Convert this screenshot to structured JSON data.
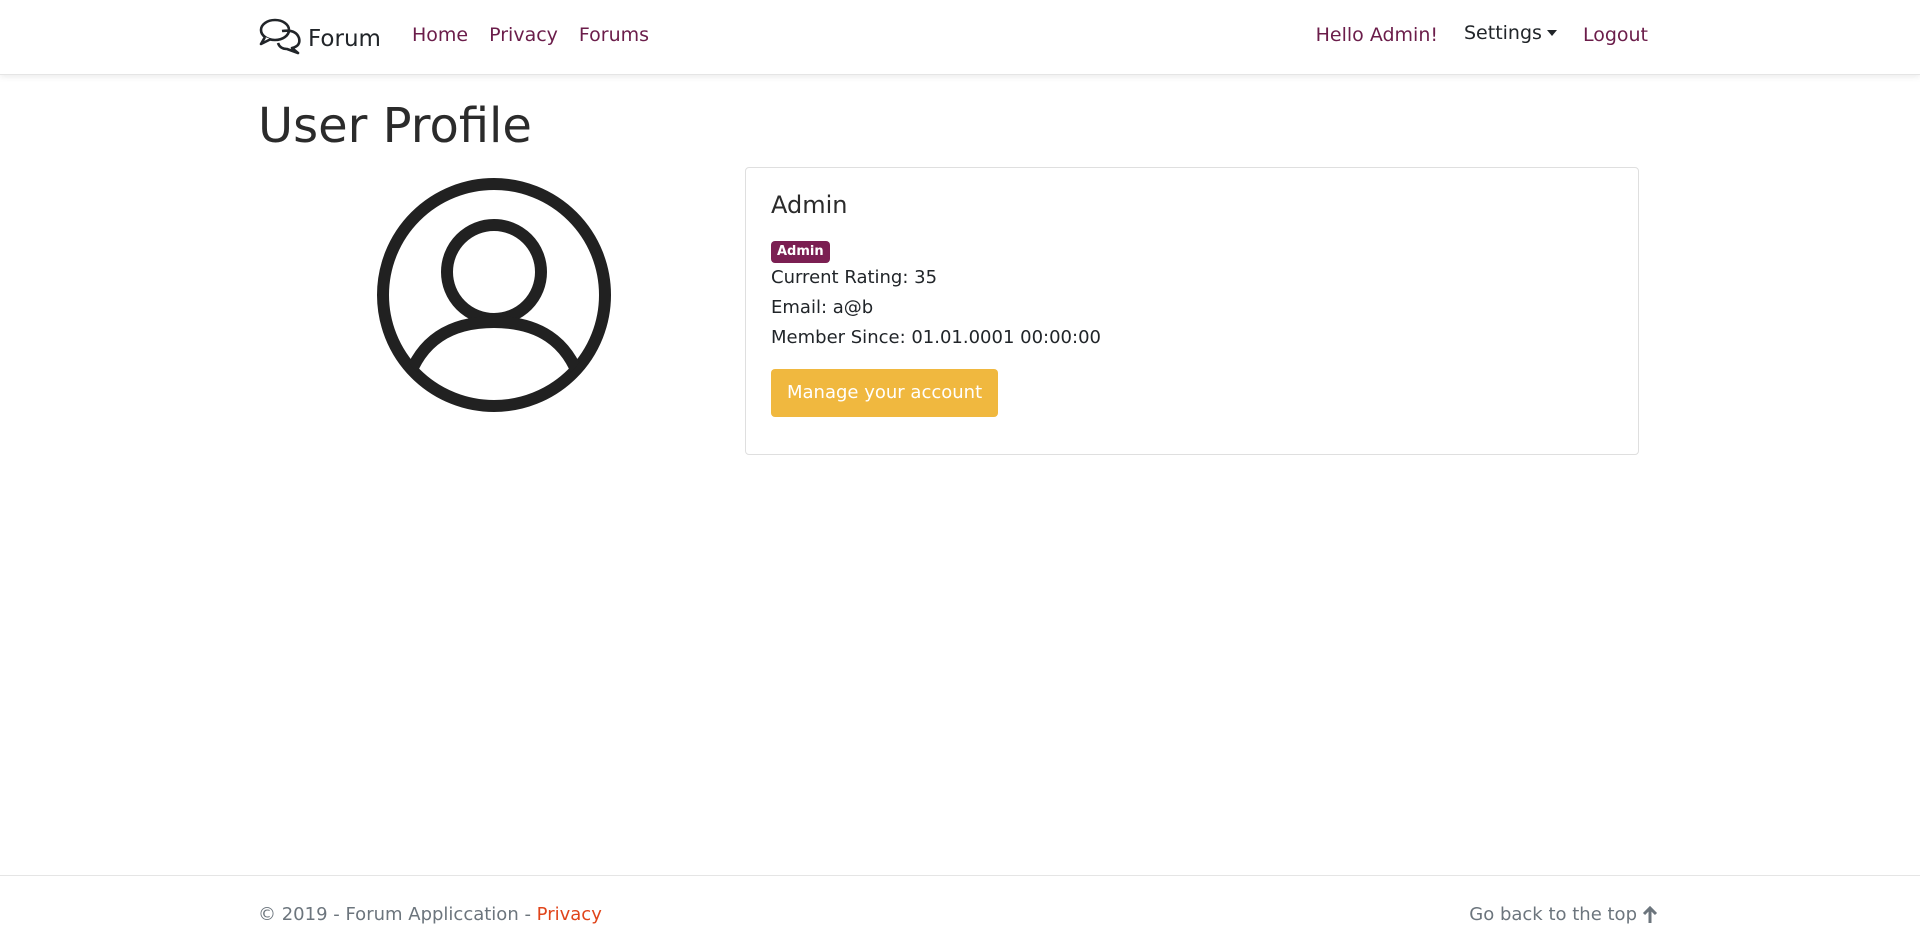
{
  "navbar": {
    "brand": "Forum",
    "links": [
      "Home",
      "Privacy",
      "Forums"
    ],
    "greeting": "Hello Admin!",
    "settings_label": "Settings",
    "logout_label": "Logout"
  },
  "page": {
    "title": "User Profile"
  },
  "profile": {
    "name": "Admin",
    "role_badge": "Admin",
    "rating": "Current Rating: 35",
    "email": "Email: a@b",
    "member_since": "Member Since: 01.01.0001 00:00:00",
    "manage_button": "Manage your account"
  },
  "footer": {
    "copyright": "© 2019 - Forum Appliccation - ",
    "privacy_link": "Privacy",
    "back_to_top": "Go back to the top"
  },
  "colors": {
    "accent": "#6b1d4a",
    "badge": "#7b1f52",
    "button": "#f0b83f",
    "footer_link": "#e0441a"
  },
  "icons": {
    "brand": "chat-bubbles-icon",
    "avatar": "user-circle-icon",
    "back_to_top": "arrow-up-icon",
    "settings_toggle": "caret-down-icon"
  }
}
